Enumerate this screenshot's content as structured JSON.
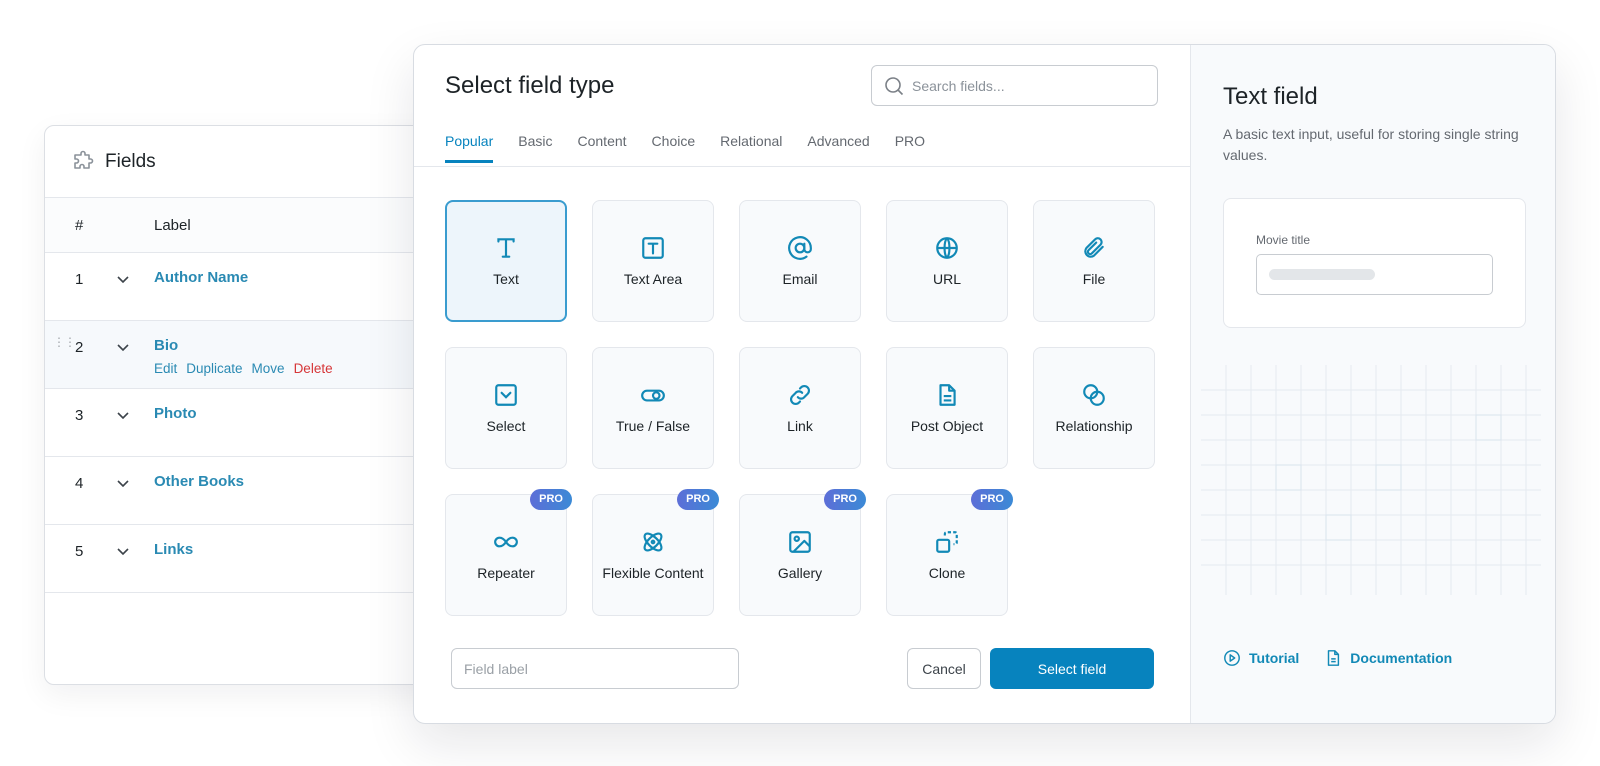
{
  "fields_panel": {
    "title": "Fields",
    "columns": {
      "num": "#",
      "label": "Label"
    },
    "rows": [
      {
        "num": "1",
        "name": "Author Name"
      },
      {
        "num": "2",
        "name": "Bio",
        "actions": [
          "Edit",
          "Duplicate",
          "Move",
          "Delete"
        ]
      },
      {
        "num": "3",
        "name": "Photo"
      },
      {
        "num": "4",
        "name": "Other Books"
      },
      {
        "num": "5",
        "name": "Links"
      }
    ]
  },
  "modal": {
    "title": "Select field type",
    "search_placeholder": "Search fields...",
    "tabs": [
      "Popular",
      "Basic",
      "Content",
      "Choice",
      "Relational",
      "Advanced",
      "PRO"
    ],
    "active_tab": "Popular",
    "tiles": [
      {
        "label": "Text",
        "icon": "text-icon",
        "selected": true
      },
      {
        "label": "Text Area",
        "icon": "text-area-icon"
      },
      {
        "label": "Email",
        "icon": "at-icon"
      },
      {
        "label": "URL",
        "icon": "globe-icon"
      },
      {
        "label": "File",
        "icon": "paperclip-icon"
      },
      {
        "label": "Select",
        "icon": "select-icon"
      },
      {
        "label": "True / False",
        "icon": "toggle-icon"
      },
      {
        "label": "Link",
        "icon": "link-icon"
      },
      {
        "label": "Post Object",
        "icon": "document-icon"
      },
      {
        "label": "Relationship",
        "icon": "relationship-icon"
      },
      {
        "label": "Repeater",
        "icon": "infinity-icon",
        "badge": "PRO"
      },
      {
        "label": "Flexible Content",
        "icon": "atom-icon",
        "badge": "PRO"
      },
      {
        "label": "Gallery",
        "icon": "image-icon",
        "badge": "PRO"
      },
      {
        "label": "Clone",
        "icon": "clone-icon",
        "badge": "PRO"
      }
    ],
    "field_label_placeholder": "Field label",
    "cancel_label": "Cancel",
    "select_label": "Select field"
  },
  "side": {
    "title": "Text field",
    "description": "A basic text input, useful for storing single string values.",
    "preview_label": "Movie title",
    "links": {
      "tutorial": "Tutorial",
      "documentation": "Documentation"
    }
  },
  "colors": {
    "accent": "#0783be",
    "link": "#2a8ab3",
    "danger": "#d63638",
    "pro_badge_start": "#5d6ed7",
    "pro_badge_end": "#3b8ad6"
  }
}
